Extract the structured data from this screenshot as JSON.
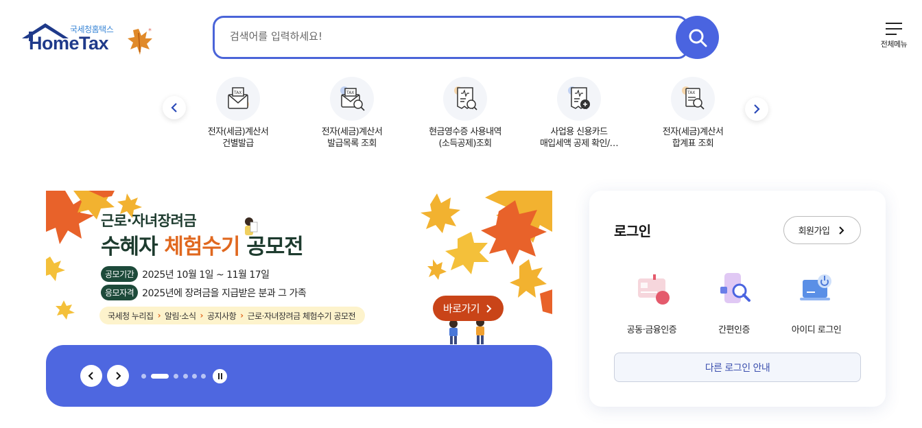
{
  "header": {
    "logo_small": "국세청홈택스",
    "logo_big": "HomeTax",
    "search_placeholder": "검색어를 입력하세요!",
    "menu_label": "전체메뉴"
  },
  "quick_menu": {
    "items": [
      {
        "label": "전자(세금)계산서\n건별발급",
        "icon": "tax-invoice-icon"
      },
      {
        "label": "전자(세금)계산서\n발급목록 조회",
        "icon": "tax-invoice-search-icon"
      },
      {
        "label": "현금영수증 사용내역\n(소득공제)조회",
        "icon": "receipt-icon"
      },
      {
        "label": "사업용 신용카드\n매입세액 공제 확인/…",
        "icon": "card-receipt-icon"
      },
      {
        "label": "전자(세금)계산서\n합계표 조회",
        "icon": "summary-search-icon"
      }
    ]
  },
  "banner": {
    "subtitle": "근로·자녀장려금",
    "title_a": "수혜자 ",
    "title_b": "체험수기",
    "title_c": " 공모전",
    "tag1": "공모기간",
    "period": "2025년 10월 1일 ~ 11월 17일",
    "tag2": "응모자격",
    "eligibility": "2025년에 장려금을 지급받은 분과 그 가족",
    "path": [
      "국세청 누리집",
      "알림·소식",
      "공지사항",
      "근로·자녀장려금 체험수기 공모전"
    ],
    "go_label": "바로가기",
    "slide_count": 6,
    "active_slide": 2
  },
  "login": {
    "title": "로그인",
    "join_label": "회원가입",
    "options": [
      {
        "label": "공동·금융인증"
      },
      {
        "label": "간편인증"
      },
      {
        "label": "아이디 로그인"
      }
    ],
    "other_label": "다른 로그인 안내"
  },
  "colors": {
    "brand_blue": "#4a64e0",
    "banner_green": "#1d3b2e",
    "banner_orange": "#e0681f"
  }
}
